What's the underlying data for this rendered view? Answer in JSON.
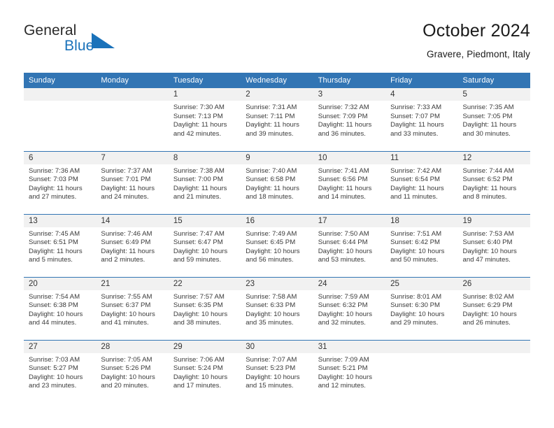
{
  "brand": {
    "line1": "General",
    "line2": "Blue",
    "triangle_icon": "triangle-icon",
    "color_text": "#2b2b2b",
    "color_accent": "#1a72ba"
  },
  "header": {
    "title": "October 2024",
    "subtitle": "Gravere, Piedmont, Italy"
  },
  "theme": {
    "header_row_bg": "#3275b4",
    "daynum_bg": "#f1f1f1",
    "divider": "#3275b4",
    "text": "#3a3a3a"
  },
  "weekdays": [
    "Sunday",
    "Monday",
    "Tuesday",
    "Wednesday",
    "Thursday",
    "Friday",
    "Saturday"
  ],
  "labels": {
    "sunrise_prefix": "Sunrise:",
    "sunset_prefix": "Sunset:",
    "daylight_prefix": "Daylight:"
  },
  "weeks": [
    [
      {
        "day": "",
        "empty": true
      },
      {
        "day": "",
        "empty": true
      },
      {
        "day": "1",
        "sunrise": "Sunrise: 7:30 AM",
        "sunset": "Sunset: 7:13 PM",
        "daylight1": "Daylight: 11 hours",
        "daylight2": "and 42 minutes."
      },
      {
        "day": "2",
        "sunrise": "Sunrise: 7:31 AM",
        "sunset": "Sunset: 7:11 PM",
        "daylight1": "Daylight: 11 hours",
        "daylight2": "and 39 minutes."
      },
      {
        "day": "3",
        "sunrise": "Sunrise: 7:32 AM",
        "sunset": "Sunset: 7:09 PM",
        "daylight1": "Daylight: 11 hours",
        "daylight2": "and 36 minutes."
      },
      {
        "day": "4",
        "sunrise": "Sunrise: 7:33 AM",
        "sunset": "Sunset: 7:07 PM",
        "daylight1": "Daylight: 11 hours",
        "daylight2": "and 33 minutes."
      },
      {
        "day": "5",
        "sunrise": "Sunrise: 7:35 AM",
        "sunset": "Sunset: 7:05 PM",
        "daylight1": "Daylight: 11 hours",
        "daylight2": "and 30 minutes."
      }
    ],
    [
      {
        "day": "6",
        "sunrise": "Sunrise: 7:36 AM",
        "sunset": "Sunset: 7:03 PM",
        "daylight1": "Daylight: 11 hours",
        "daylight2": "and 27 minutes."
      },
      {
        "day": "7",
        "sunrise": "Sunrise: 7:37 AM",
        "sunset": "Sunset: 7:01 PM",
        "daylight1": "Daylight: 11 hours",
        "daylight2": "and 24 minutes."
      },
      {
        "day": "8",
        "sunrise": "Sunrise: 7:38 AM",
        "sunset": "Sunset: 7:00 PM",
        "daylight1": "Daylight: 11 hours",
        "daylight2": "and 21 minutes."
      },
      {
        "day": "9",
        "sunrise": "Sunrise: 7:40 AM",
        "sunset": "Sunset: 6:58 PM",
        "daylight1": "Daylight: 11 hours",
        "daylight2": "and 18 minutes."
      },
      {
        "day": "10",
        "sunrise": "Sunrise: 7:41 AM",
        "sunset": "Sunset: 6:56 PM",
        "daylight1": "Daylight: 11 hours",
        "daylight2": "and 14 minutes."
      },
      {
        "day": "11",
        "sunrise": "Sunrise: 7:42 AM",
        "sunset": "Sunset: 6:54 PM",
        "daylight1": "Daylight: 11 hours",
        "daylight2": "and 11 minutes."
      },
      {
        "day": "12",
        "sunrise": "Sunrise: 7:44 AM",
        "sunset": "Sunset: 6:52 PM",
        "daylight1": "Daylight: 11 hours",
        "daylight2": "and 8 minutes."
      }
    ],
    [
      {
        "day": "13",
        "sunrise": "Sunrise: 7:45 AM",
        "sunset": "Sunset: 6:51 PM",
        "daylight1": "Daylight: 11 hours",
        "daylight2": "and 5 minutes."
      },
      {
        "day": "14",
        "sunrise": "Sunrise: 7:46 AM",
        "sunset": "Sunset: 6:49 PM",
        "daylight1": "Daylight: 11 hours",
        "daylight2": "and 2 minutes."
      },
      {
        "day": "15",
        "sunrise": "Sunrise: 7:47 AM",
        "sunset": "Sunset: 6:47 PM",
        "daylight1": "Daylight: 10 hours",
        "daylight2": "and 59 minutes."
      },
      {
        "day": "16",
        "sunrise": "Sunrise: 7:49 AM",
        "sunset": "Sunset: 6:45 PM",
        "daylight1": "Daylight: 10 hours",
        "daylight2": "and 56 minutes."
      },
      {
        "day": "17",
        "sunrise": "Sunrise: 7:50 AM",
        "sunset": "Sunset: 6:44 PM",
        "daylight1": "Daylight: 10 hours",
        "daylight2": "and 53 minutes."
      },
      {
        "day": "18",
        "sunrise": "Sunrise: 7:51 AM",
        "sunset": "Sunset: 6:42 PM",
        "daylight1": "Daylight: 10 hours",
        "daylight2": "and 50 minutes."
      },
      {
        "day": "19",
        "sunrise": "Sunrise: 7:53 AM",
        "sunset": "Sunset: 6:40 PM",
        "daylight1": "Daylight: 10 hours",
        "daylight2": "and 47 minutes."
      }
    ],
    [
      {
        "day": "20",
        "sunrise": "Sunrise: 7:54 AM",
        "sunset": "Sunset: 6:38 PM",
        "daylight1": "Daylight: 10 hours",
        "daylight2": "and 44 minutes."
      },
      {
        "day": "21",
        "sunrise": "Sunrise: 7:55 AM",
        "sunset": "Sunset: 6:37 PM",
        "daylight1": "Daylight: 10 hours",
        "daylight2": "and 41 minutes."
      },
      {
        "day": "22",
        "sunrise": "Sunrise: 7:57 AM",
        "sunset": "Sunset: 6:35 PM",
        "daylight1": "Daylight: 10 hours",
        "daylight2": "and 38 minutes."
      },
      {
        "day": "23",
        "sunrise": "Sunrise: 7:58 AM",
        "sunset": "Sunset: 6:33 PM",
        "daylight1": "Daylight: 10 hours",
        "daylight2": "and 35 minutes."
      },
      {
        "day": "24",
        "sunrise": "Sunrise: 7:59 AM",
        "sunset": "Sunset: 6:32 PM",
        "daylight1": "Daylight: 10 hours",
        "daylight2": "and 32 minutes."
      },
      {
        "day": "25",
        "sunrise": "Sunrise: 8:01 AM",
        "sunset": "Sunset: 6:30 PM",
        "daylight1": "Daylight: 10 hours",
        "daylight2": "and 29 minutes."
      },
      {
        "day": "26",
        "sunrise": "Sunrise: 8:02 AM",
        "sunset": "Sunset: 6:29 PM",
        "daylight1": "Daylight: 10 hours",
        "daylight2": "and 26 minutes."
      }
    ],
    [
      {
        "day": "27",
        "sunrise": "Sunrise: 7:03 AM",
        "sunset": "Sunset: 5:27 PM",
        "daylight1": "Daylight: 10 hours",
        "daylight2": "and 23 minutes."
      },
      {
        "day": "28",
        "sunrise": "Sunrise: 7:05 AM",
        "sunset": "Sunset: 5:26 PM",
        "daylight1": "Daylight: 10 hours",
        "daylight2": "and 20 minutes."
      },
      {
        "day": "29",
        "sunrise": "Sunrise: 7:06 AM",
        "sunset": "Sunset: 5:24 PM",
        "daylight1": "Daylight: 10 hours",
        "daylight2": "and 17 minutes."
      },
      {
        "day": "30",
        "sunrise": "Sunrise: 7:07 AM",
        "sunset": "Sunset: 5:23 PM",
        "daylight1": "Daylight: 10 hours",
        "daylight2": "and 15 minutes."
      },
      {
        "day": "31",
        "sunrise": "Sunrise: 7:09 AM",
        "sunset": "Sunset: 5:21 PM",
        "daylight1": "Daylight: 10 hours",
        "daylight2": "and 12 minutes."
      },
      {
        "day": "",
        "empty": true
      },
      {
        "day": "",
        "empty": true
      }
    ]
  ]
}
